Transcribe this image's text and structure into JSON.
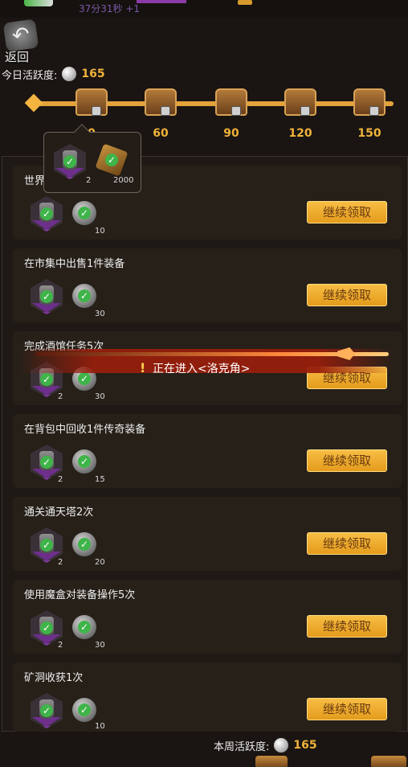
{
  "header": {
    "timer_text": "37分31秒 +1",
    "back_label": "返回",
    "today_activity_label": "今日活跃度:",
    "today_activity_value": "165"
  },
  "milestones": [
    {
      "label": "0"
    },
    {
      "label": "60"
    },
    {
      "label": "90"
    },
    {
      "label": "120"
    },
    {
      "label": "150"
    }
  ],
  "tooltip": {
    "items": [
      {
        "icon": "jar-icon",
        "count": "2"
      },
      {
        "icon": "crate-icon",
        "count": "2000"
      }
    ]
  },
  "tasks": [
    {
      "title": "世界",
      "jar_count": "",
      "coin_count": "10",
      "button": "继续领取"
    },
    {
      "title": "在市集中出售1件装备",
      "jar_count": "",
      "coin_count": "30",
      "button": "继续领取"
    },
    {
      "title": "完成酒馆任务5次",
      "jar_count": "2",
      "coin_count": "30",
      "button": "继续领取"
    },
    {
      "title": "在背包中回收1件传奇装备",
      "jar_count": "2",
      "coin_count": "15",
      "button": "继续领取"
    },
    {
      "title": "通关通天塔2次",
      "jar_count": "2",
      "coin_count": "20",
      "button": "继续领取"
    },
    {
      "title": "使用魔盒对装备操作5次",
      "jar_count": "2",
      "coin_count": "30",
      "button": "继续领取"
    },
    {
      "title": "矿洞收获1次",
      "jar_count": "",
      "coin_count": "10",
      "button": "继续领取"
    }
  ],
  "banner": {
    "exclamation": "!",
    "text": "正在进入<洛克角>"
  },
  "footer": {
    "week_activity_label": "本周活跃度:",
    "week_activity_value": "165"
  },
  "colors": {
    "accent_gold": "#f0b23a",
    "button_gold": "#f7be44",
    "check_green": "#3fb449",
    "rarity_purple": "#7a3a9a"
  }
}
